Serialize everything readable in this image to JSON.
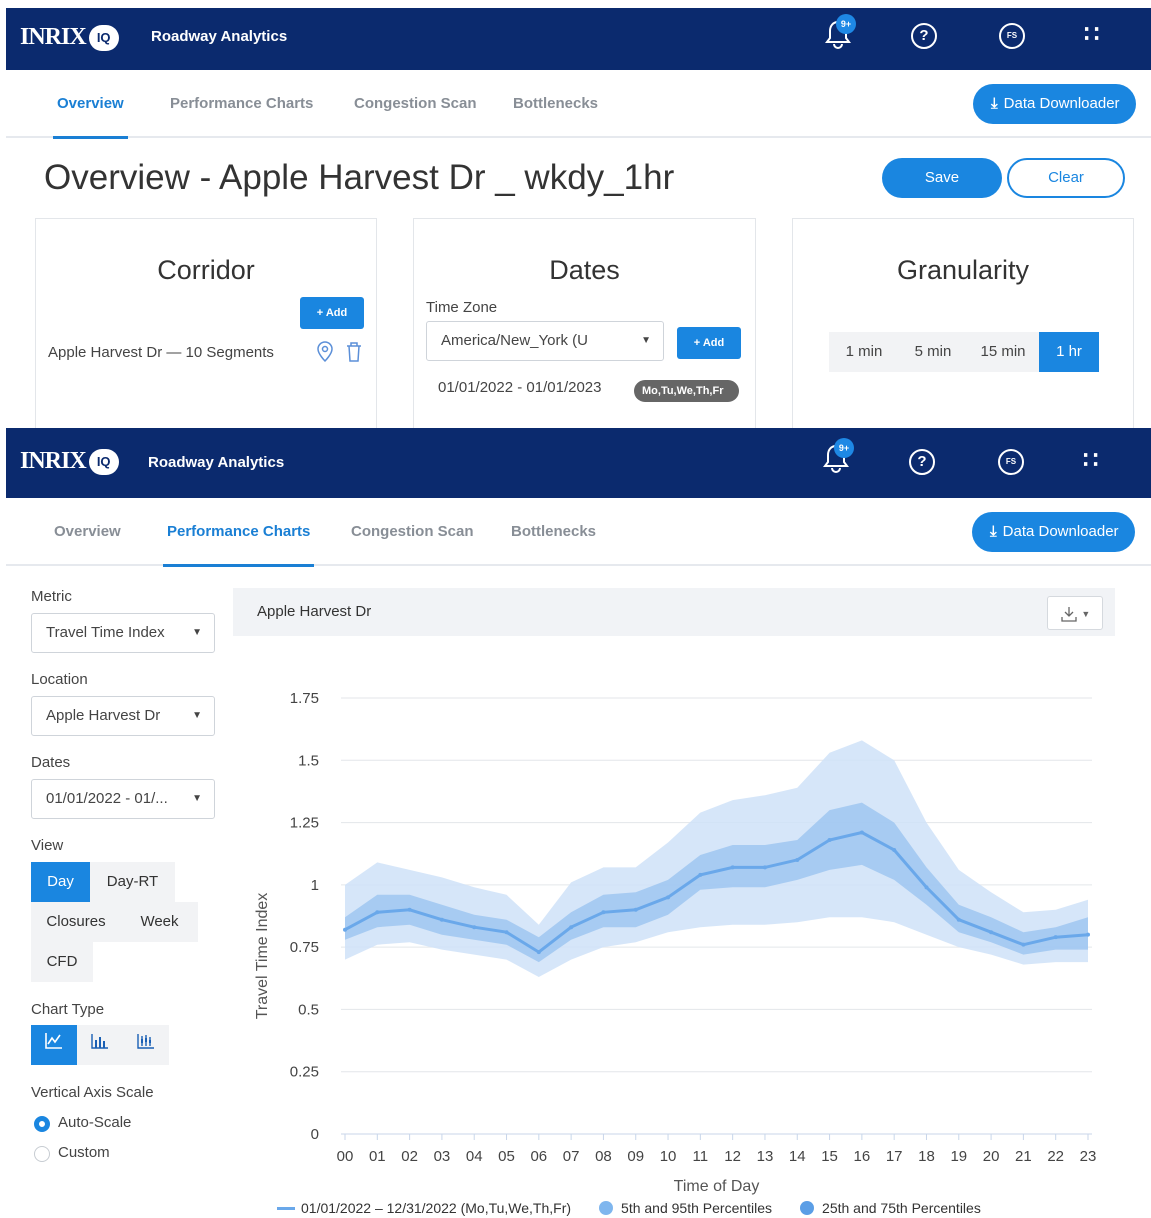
{
  "top": {
    "logo_text": "INRIX",
    "logo_badge": "IQ",
    "app_name": "Roadway Analytics",
    "notification_count": "9+",
    "help_icon_glyph": "?",
    "user_initials": "FS",
    "apps_glyph": "∷"
  },
  "tabs": [
    "Overview",
    "Performance Charts",
    "Congestion Scan",
    "Bottlenecks"
  ],
  "downloader_label": "Data Downloader",
  "overview": {
    "title": "Overview - Apple Harvest Dr _ wkdy_1hr",
    "save_label": "Save",
    "clear_label": "Clear",
    "corridor": {
      "title": "Corridor",
      "add_label": "+ Add",
      "item": "Apple Harvest Dr — 10 Segments"
    },
    "dates": {
      "title": "Dates",
      "timezone_label": "Time Zone",
      "timezone_value": "America/New_York (U",
      "add_label": "+ Add",
      "range": "01/01/2022 - 01/01/2023",
      "days_pill": "Mo,Tu,We,Th,Fr"
    },
    "granularity": {
      "title": "Granularity",
      "options": [
        "1 min",
        "5 min",
        "15 min",
        "1 hr"
      ],
      "selected": "1 hr"
    }
  },
  "perf": {
    "metric_label": "Metric",
    "metric_value": "Travel Time Index",
    "location_label": "Location",
    "location_value": "Apple Harvest Dr",
    "dates_label": "Dates",
    "dates_value": "01/01/2022 - 01/...",
    "view_label": "View",
    "view_options": [
      "Day",
      "Day-RT",
      "Closures",
      "Week",
      "CFD"
    ],
    "view_selected": "Day",
    "chart_type_label": "Chart Type",
    "chart_type_icons": [
      "line-chart-icon",
      "bar-chart-icon",
      "box-plot-icon"
    ],
    "chart_type_selected": "line-chart-icon",
    "axis_scale_label": "Vertical Axis Scale",
    "axis_scale_options": [
      "Auto-Scale",
      "Custom"
    ],
    "axis_scale_selected": "Auto-Scale",
    "chart_panel_title": "Apple Harvest Dr"
  },
  "colors": {
    "nav": "#0b2a6e",
    "accent": "#1a86e0",
    "median_line": "#6aa8ea",
    "band_5_95": "#cfe2f8",
    "band_25_75": "#97c2ef"
  },
  "chart_data": {
    "type": "area",
    "xlabel": "Time of Day",
    "ylabel": "Travel Time Index",
    "x": [
      "00",
      "01",
      "02",
      "03",
      "04",
      "05",
      "06",
      "07",
      "08",
      "09",
      "10",
      "11",
      "12",
      "13",
      "14",
      "15",
      "16",
      "17",
      "18",
      "19",
      "20",
      "21",
      "22",
      "23"
    ],
    "ylim": [
      0,
      1.75
    ],
    "yticks": [
      {
        "v": 0,
        "label": "0"
      },
      {
        "v": 0.25,
        "label": "0.25"
      },
      {
        "v": 0.5,
        "label": "0.5"
      },
      {
        "v": 0.75,
        "label": "0.75"
      },
      {
        "v": 1,
        "label": "1"
      },
      {
        "v": 1.25,
        "label": "1.25"
      },
      {
        "v": 1.5,
        "label": "1.5"
      },
      {
        "v": 1.75,
        "label": "1.75"
      }
    ],
    "grid": true,
    "legend_position": "bottom",
    "series": [
      {
        "name": "01/01/2022 – 12/31/2022 (Mo,Tu,We,Th,Fr)",
        "kind": "line",
        "values": [
          0.82,
          0.89,
          0.9,
          0.86,
          0.83,
          0.81,
          0.73,
          0.83,
          0.89,
          0.9,
          0.95,
          1.04,
          1.07,
          1.07,
          1.1,
          1.18,
          1.21,
          1.14,
          0.99,
          0.86,
          0.81,
          0.76,
          0.79,
          0.8
        ]
      },
      {
        "name": "5th and 95th Percentiles",
        "kind": "band",
        "low": [
          0.7,
          0.76,
          0.77,
          0.74,
          0.72,
          0.7,
          0.63,
          0.7,
          0.75,
          0.77,
          0.81,
          0.83,
          0.84,
          0.84,
          0.85,
          0.87,
          0.87,
          0.85,
          0.8,
          0.75,
          0.72,
          0.68,
          0.69,
          0.69
        ],
        "high": [
          1.0,
          1.09,
          1.06,
          1.03,
          0.99,
          0.96,
          0.84,
          1.01,
          1.07,
          1.07,
          1.17,
          1.29,
          1.34,
          1.36,
          1.39,
          1.53,
          1.58,
          1.5,
          1.25,
          1.06,
          0.97,
          0.89,
          0.9,
          0.94
        ]
      },
      {
        "name": "25th and 75th Percentiles",
        "kind": "band",
        "low": [
          0.78,
          0.83,
          0.84,
          0.8,
          0.78,
          0.76,
          0.69,
          0.78,
          0.83,
          0.83,
          0.88,
          0.98,
          0.99,
          0.99,
          1.02,
          1.06,
          1.08,
          1.02,
          0.92,
          0.81,
          0.77,
          0.72,
          0.74,
          0.74
        ],
        "high": [
          0.87,
          0.96,
          0.96,
          0.92,
          0.88,
          0.86,
          0.79,
          0.89,
          0.96,
          0.97,
          1.02,
          1.12,
          1.16,
          1.16,
          1.18,
          1.3,
          1.33,
          1.25,
          1.07,
          0.92,
          0.87,
          0.81,
          0.83,
          0.87
        ]
      }
    ]
  }
}
